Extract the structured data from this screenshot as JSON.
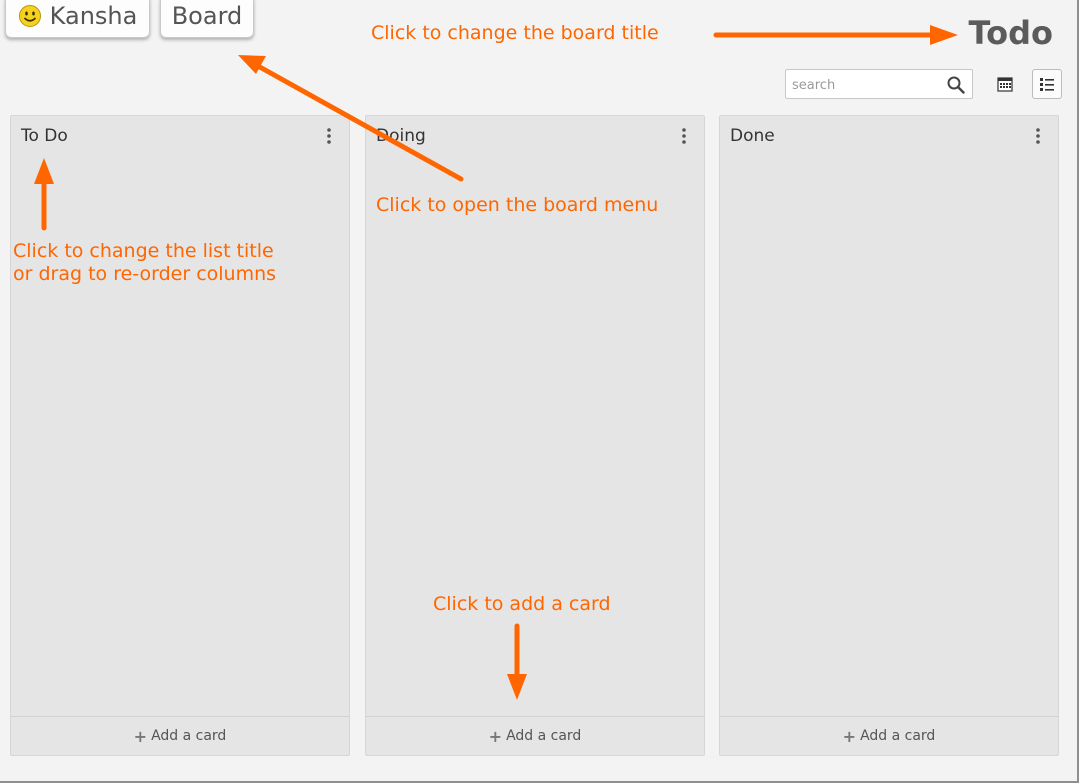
{
  "header": {
    "brand_label": "Kansha",
    "board_menu_label": "Board",
    "board_title": "Todo"
  },
  "toolbar": {
    "search_placeholder": "search",
    "search_value": "",
    "icons": [
      "search-icon",
      "calendar-icon",
      "list-view-icon"
    ]
  },
  "columns": [
    {
      "title": "To Do",
      "add_card_label": "Add a card"
    },
    {
      "title": "Doing",
      "add_card_label": "Add a card"
    },
    {
      "title": "Done",
      "add_card_label": "Add a card"
    }
  ],
  "annotations": {
    "board_title_hint": "Click to change the board title",
    "board_menu_hint": "Click to open the board menu",
    "list_title_hint_line1": "Click to change the list title",
    "list_title_hint_line2": "or drag to re-order columns",
    "add_card_hint": "Click to add a card"
  },
  "colors": {
    "annotation": "#ff6600",
    "background": "#f3f3f3",
    "column": "#e5e5e5"
  }
}
